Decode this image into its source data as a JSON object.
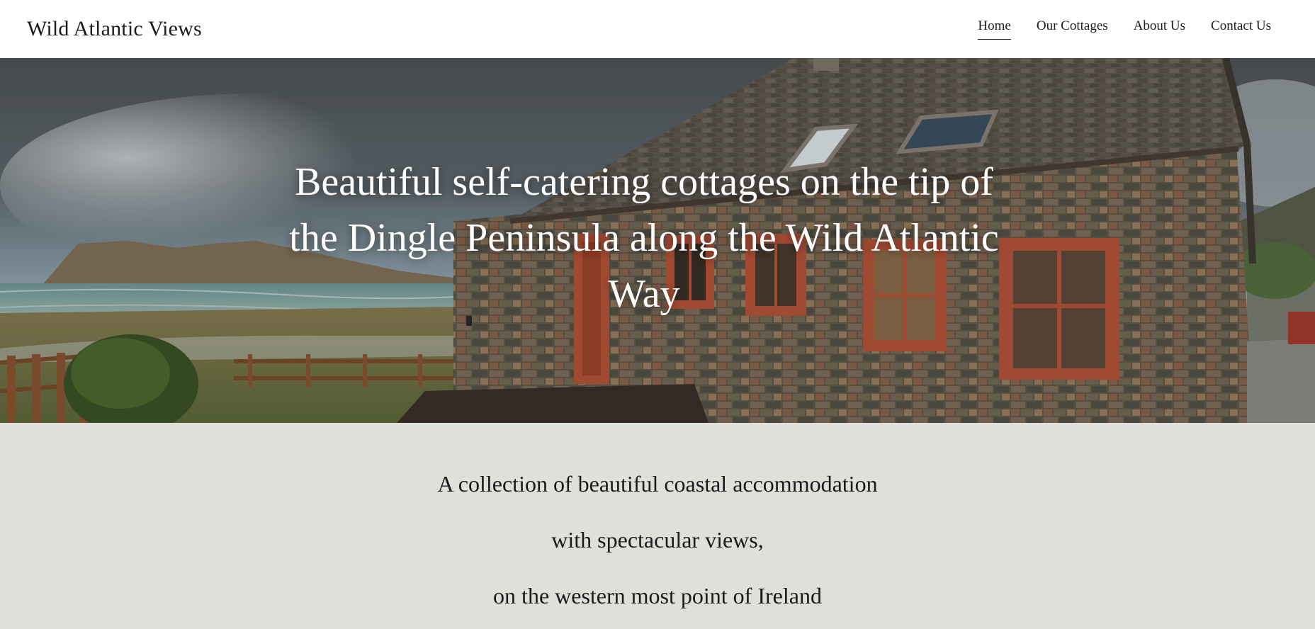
{
  "site": {
    "title": "Wild Atlantic Views"
  },
  "nav": {
    "items": [
      {
        "label": "Home",
        "active": true
      },
      {
        "label": "Our Cottages",
        "active": false
      },
      {
        "label": "About Us",
        "active": false
      },
      {
        "label": "Contact Us",
        "active": false
      }
    ]
  },
  "hero": {
    "heading": "Beautiful self-catering cottages on the tip of the Dingle Peninsula along the Wild Atlantic Way",
    "image": "stone-cottage-coastal-photo"
  },
  "intro": {
    "lines": [
      "A collection of beautiful coastal  accommodation",
      "with spectacular views,",
      "on the western most point of Ireland"
    ]
  },
  "colors": {
    "header_bg": "#ffffff",
    "intro_bg": "#e0dfdb",
    "text": "#1a1a1a",
    "hero_text": "#ffffff",
    "window_frame": "#b8553a"
  }
}
